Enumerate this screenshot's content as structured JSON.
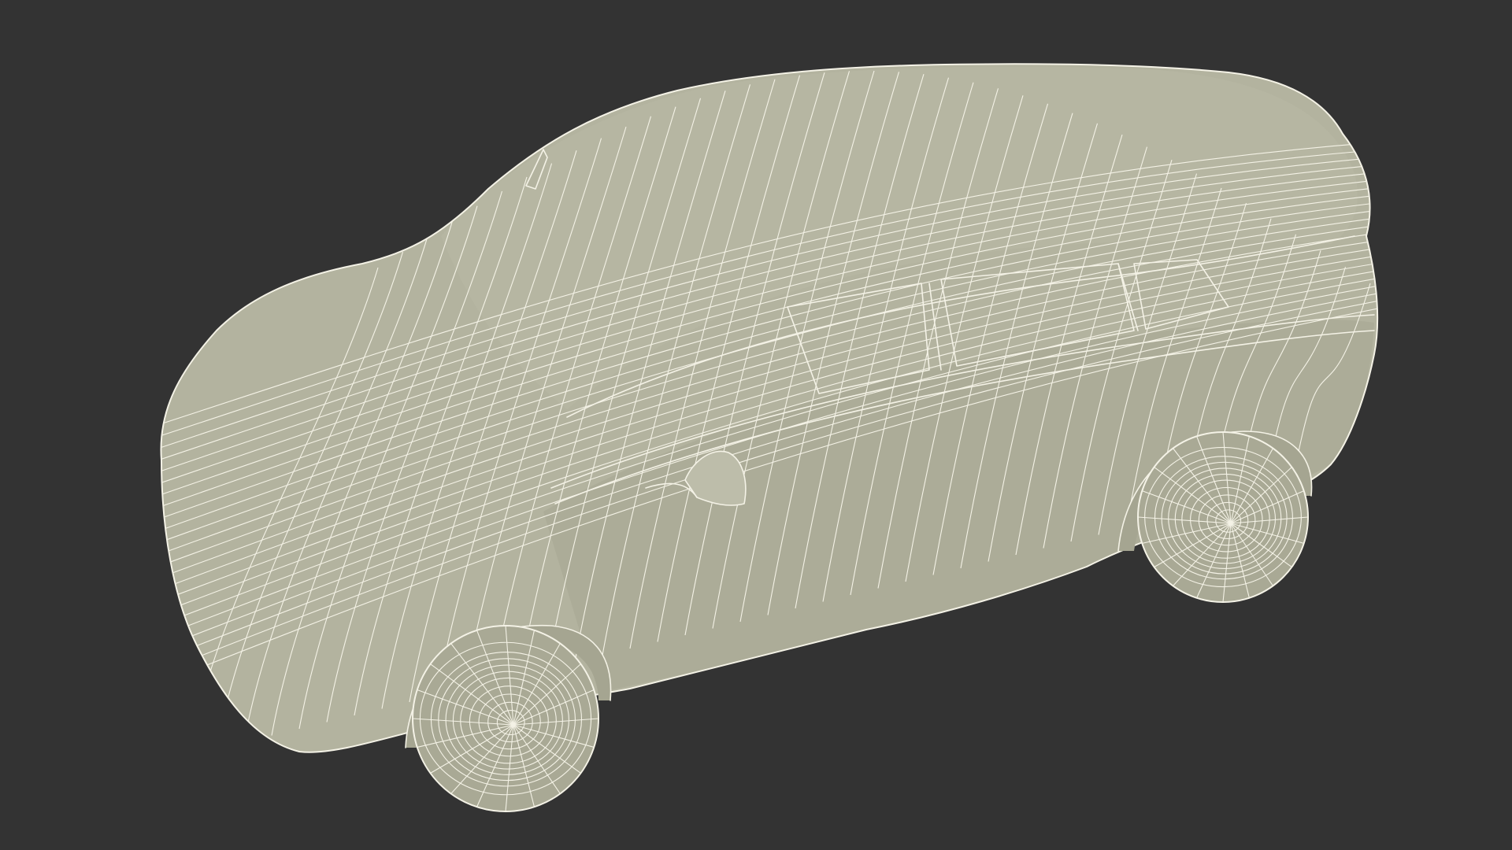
{
  "scene": {
    "subject": "car-wireframe-model",
    "background_color": "#333333",
    "body_color": "#b3b39f",
    "wire_color": "#f4f2e6"
  }
}
